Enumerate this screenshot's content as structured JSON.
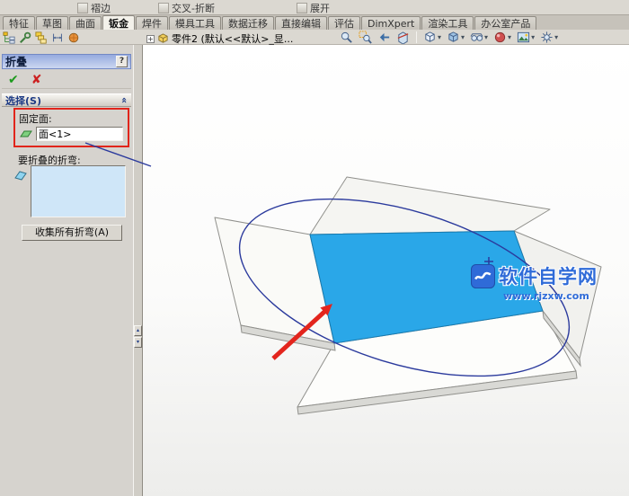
{
  "colors": {
    "selected_face": "#2aa7e8",
    "sketch": "#2b3a9d",
    "arrow": "#e3251d",
    "highlight": "#e1251b",
    "watermark": "#2f6bd8"
  },
  "top_strip": {
    "items": [
      "褶边",
      "交叉-折断",
      "展开"
    ]
  },
  "tabs": {
    "items": [
      "特征",
      "草图",
      "曲面",
      "钣金",
      "焊件",
      "模具工具",
      "数据迁移",
      "直接编辑",
      "评估",
      "DimXpert",
      "渲染工具",
      "办公室产品"
    ],
    "active": "钣金"
  },
  "manager_row": {
    "part_label": "零件2 (默认<<默认>_显...",
    "panel_tabs": [
      "featuremanager-tree",
      "propertymanager",
      "configurationmanager",
      "dimxpertmanager",
      "displaymanager"
    ]
  },
  "view_toolbar": {
    "buttons": [
      "zoom-fit",
      "zoom-area",
      "previous-view",
      "section-view",
      "view-orientation",
      "display-style",
      "hide-show-items",
      "edit-appearance",
      "apply-scene",
      "view-settings"
    ]
  },
  "ui": {
    "caret": "▾",
    "plus": "+",
    "collapse": "«",
    "help": "?",
    "scroll_up": "▴",
    "scroll_down": "▾"
  },
  "property_manager": {
    "title": "折叠",
    "ok": "✔",
    "cancel": "✘",
    "section_selection": "选择(S)",
    "fixed_face_label": "固定面:",
    "fixed_face_value": "面<1>",
    "bends_label": "要折叠的折弯:",
    "collect_button": "收集所有折弯(A)"
  },
  "viewport": {
    "watermark_title": "软件自学网",
    "watermark_url": "www.rjzxw.com"
  }
}
